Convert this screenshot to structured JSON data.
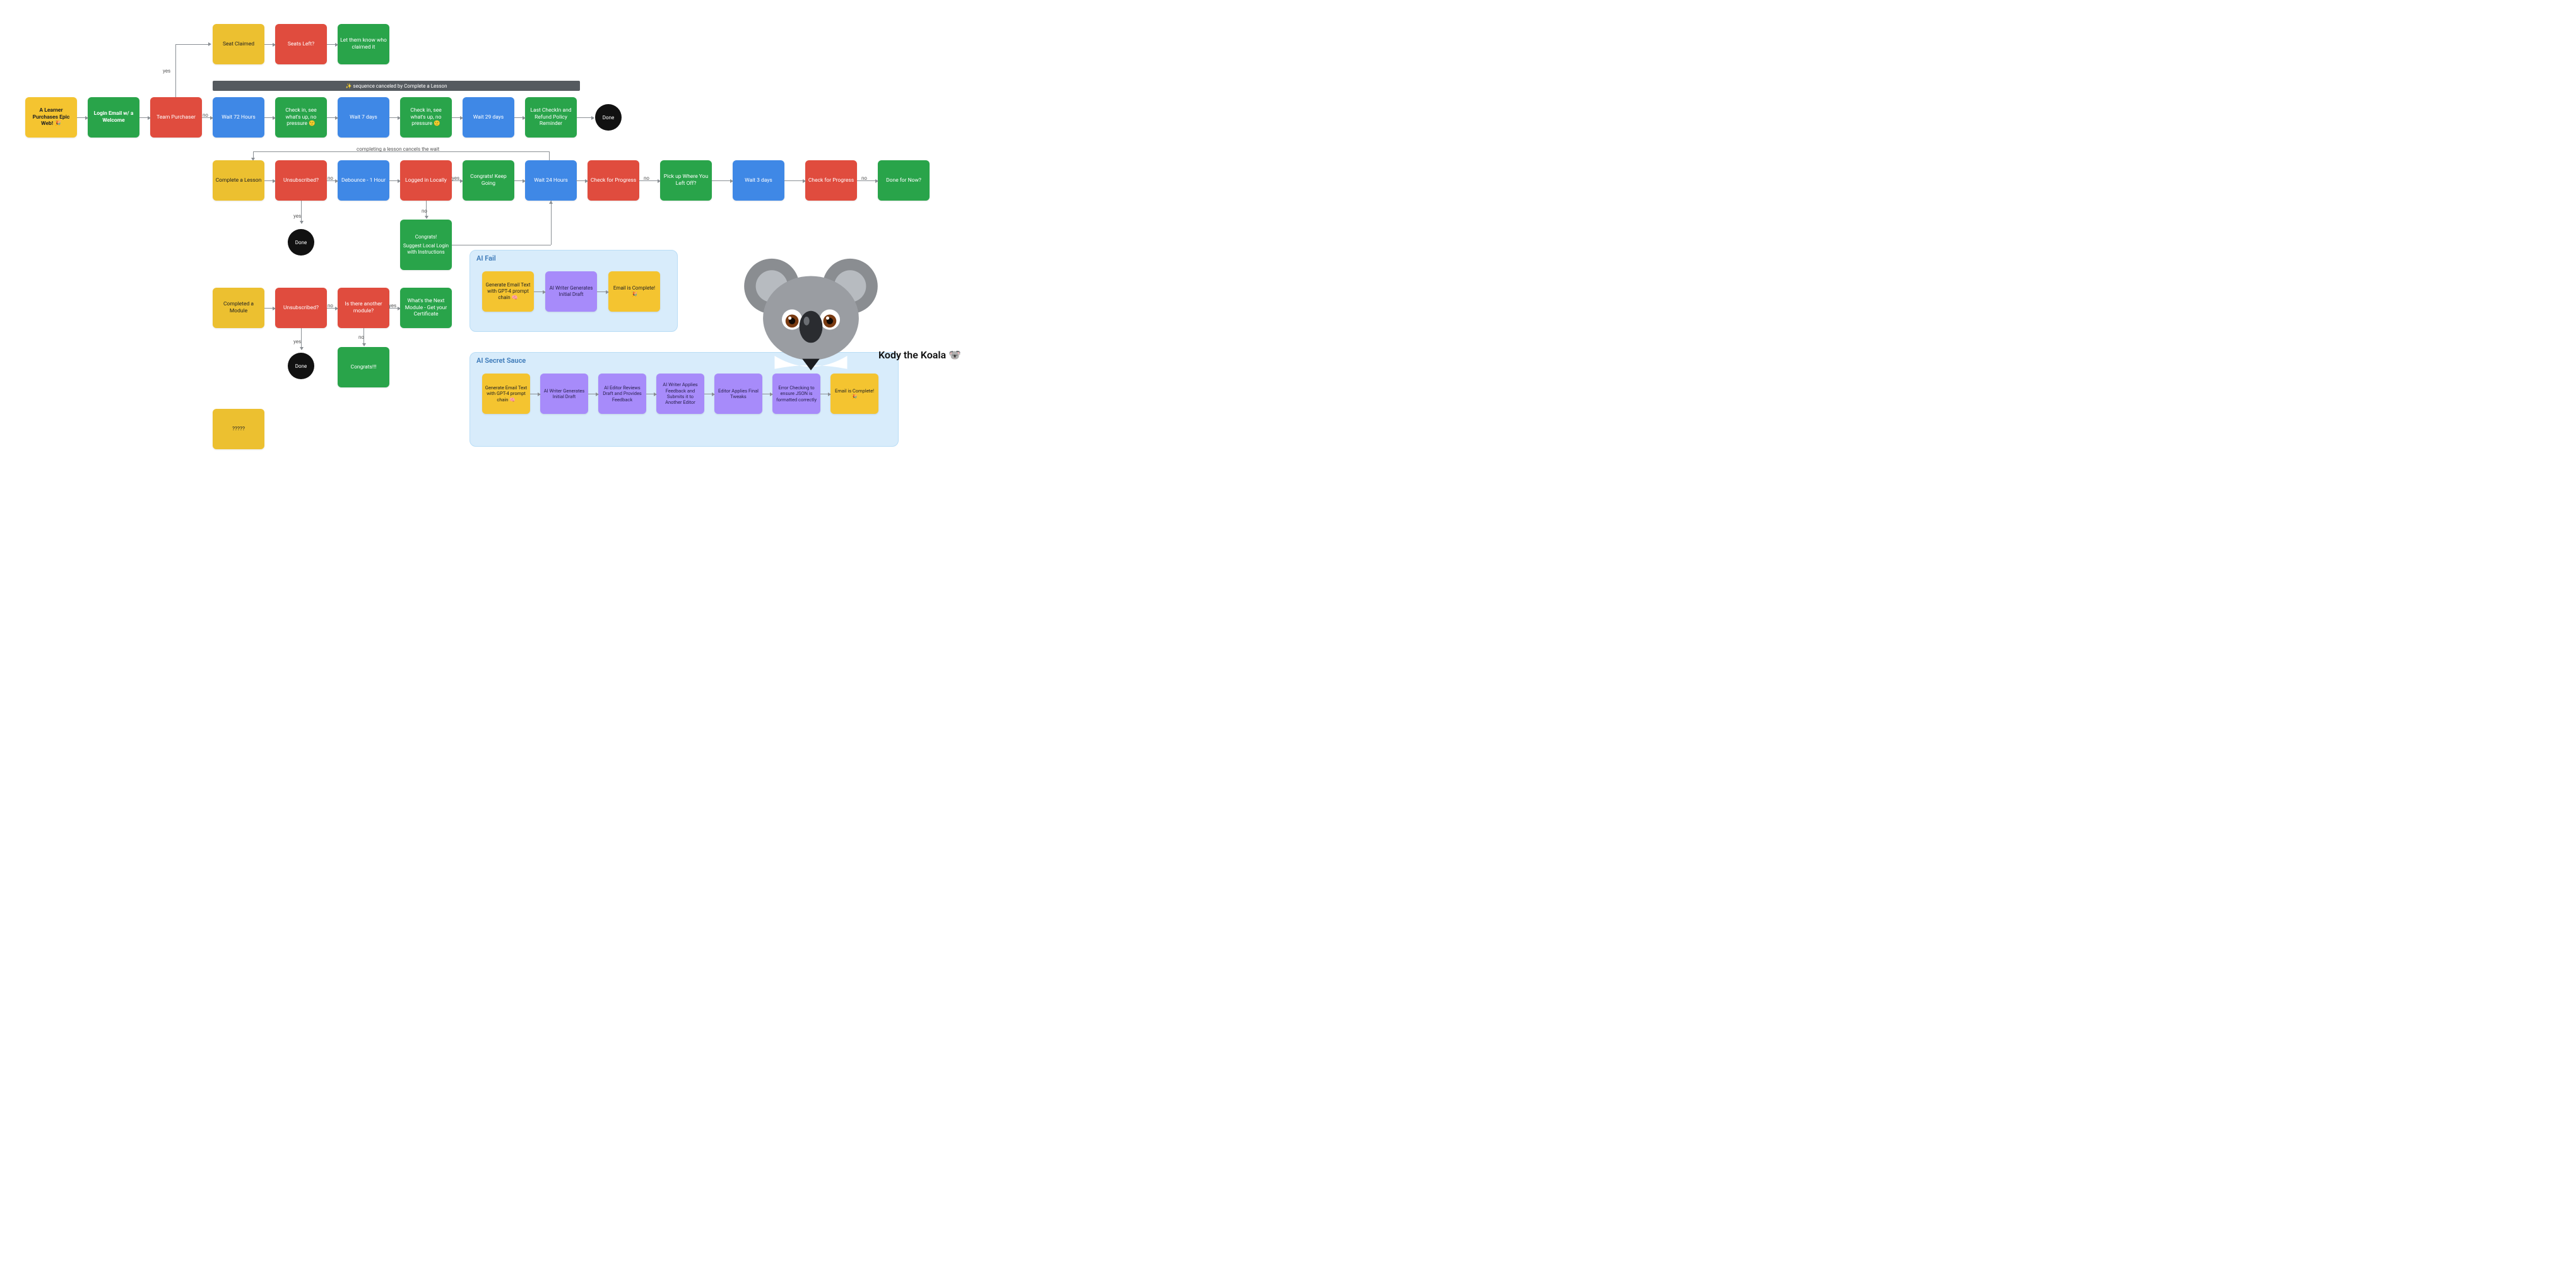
{
  "row_top": {
    "seat_claimed": "Seat Claimed",
    "seats_left": "Seats Left?",
    "let_know": "Let them know who claimed it"
  },
  "row_main": {
    "learner": "A Learner Purchases Epic Web! 🎉",
    "login_email": "Login Email w/ a Welcome",
    "team_purchaser": "Team Purchaser",
    "wait72": "Wait 72 Hours",
    "checkin1": "Check in, see what's up, no pressure 🙂",
    "wait7": "Wait 7 days",
    "checkin2": "Check in, see what's up, no pressure 🙂",
    "wait29": "Wait 29 days",
    "last_checkin": "Last CheckIn and Refund Policy Reminder",
    "done": "Done"
  },
  "banner": "✨ sequence canceled by Complete a Lesson",
  "cancel_label": "completing a lesson cancels the wait",
  "row_lesson": {
    "complete_lesson": "Complete a Lesson",
    "unsubscribed": "Unsubscribed?",
    "debounce": "Debounce - 1 Hour",
    "logged_in": "Logged in Locally",
    "congrats_going": "Congrats! Keep Going",
    "wait24": "Wait 24 Hours",
    "check_progress": "Check for Progress",
    "pickup": "Pick up Where You Left Off?",
    "wait3": "Wait 3 days",
    "check_progress2": "Check for Progress",
    "done_for_now": "Done for Now?",
    "done": "Done",
    "congrats_suggest_title": "Congrats!",
    "congrats_suggest_body": "Suggest Local Login with Instructions"
  },
  "row_module": {
    "completed_module": "Completed a Module",
    "unsubscribed": "Unsubscribed?",
    "another_module": "Is there another module?",
    "whats_next": "What's the Next Module - Get your Certificate",
    "congrats": "Congrats!!!",
    "done": "Done"
  },
  "labels": {
    "yes": "yes",
    "no": "no"
  },
  "row_mystery": "?????",
  "ai_fail": {
    "title": "AI Fail",
    "a": "Generate Email Text with GPT-4 prompt chain 🧠",
    "b": "AI Writer Generates Initial Draft",
    "c": "Email is Complete! 🎉"
  },
  "ai_secret": {
    "title": "AI Secret Sauce",
    "a": "Generate Email Text with GPT-4 prompt chain 🧠",
    "b": "AI Writer Generates Initial Draft",
    "c": "AI Editor Reviews Draft and Provides Feedback",
    "d": "AI Writer Applies Feedback and Submits it to Another Editor",
    "e": "Editor Applies Final Tweaks",
    "f": "Error Checking to ensure JSON is formatted correctly",
    "g": "Email is Complete! 🎉"
  },
  "caption": "Kody the Koala 🐨"
}
